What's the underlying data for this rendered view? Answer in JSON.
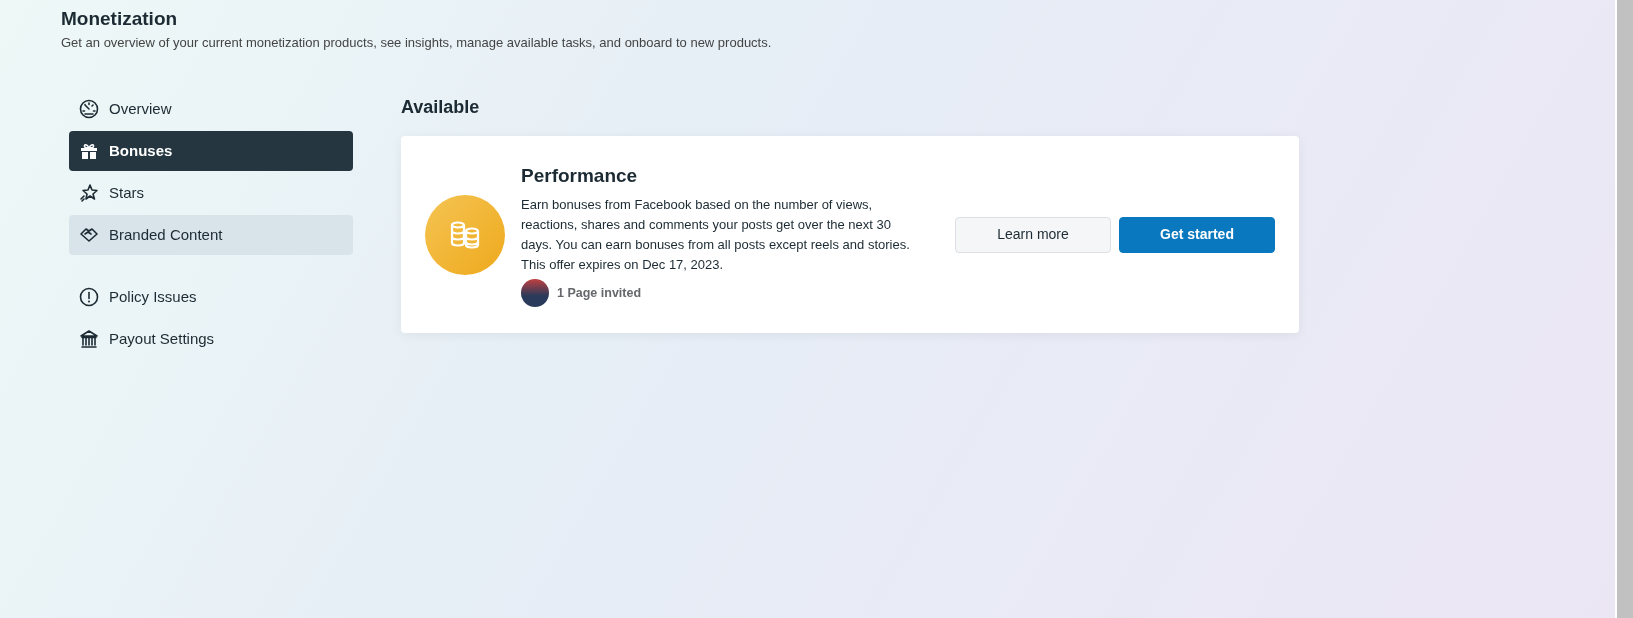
{
  "header": {
    "title": "Monetization",
    "subtitle": "Get an overview of your current monetization products, see insights, manage available tasks, and onboard to new products."
  },
  "sidebar": {
    "groups": [
      {
        "items": [
          {
            "label": "Overview",
            "selected": false,
            "hovered": false
          },
          {
            "label": "Bonuses",
            "selected": true,
            "hovered": false
          },
          {
            "label": "Stars",
            "selected": false,
            "hovered": false
          },
          {
            "label": "Branded Content",
            "selected": false,
            "hovered": true
          }
        ]
      },
      {
        "items": [
          {
            "label": "Policy Issues",
            "selected": false,
            "hovered": false
          },
          {
            "label": "Payout Settings",
            "selected": false,
            "hovered": false
          }
        ]
      }
    ]
  },
  "section_title": "Available",
  "offers": [
    {
      "title": "Performance",
      "description": "Earn bonuses from Facebook based on the number of views, reactions, shares and comments your posts get over the next 30 days. You can earn bonuses from all posts except reels and stories. This offer expires on Dec 17, 2023.",
      "invited": "1 Page invited",
      "buttons": [
        {
          "label": "Learn more",
          "kind": "secondary"
        },
        {
          "label": "Get started",
          "kind": "primary"
        }
      ]
    }
  ]
}
